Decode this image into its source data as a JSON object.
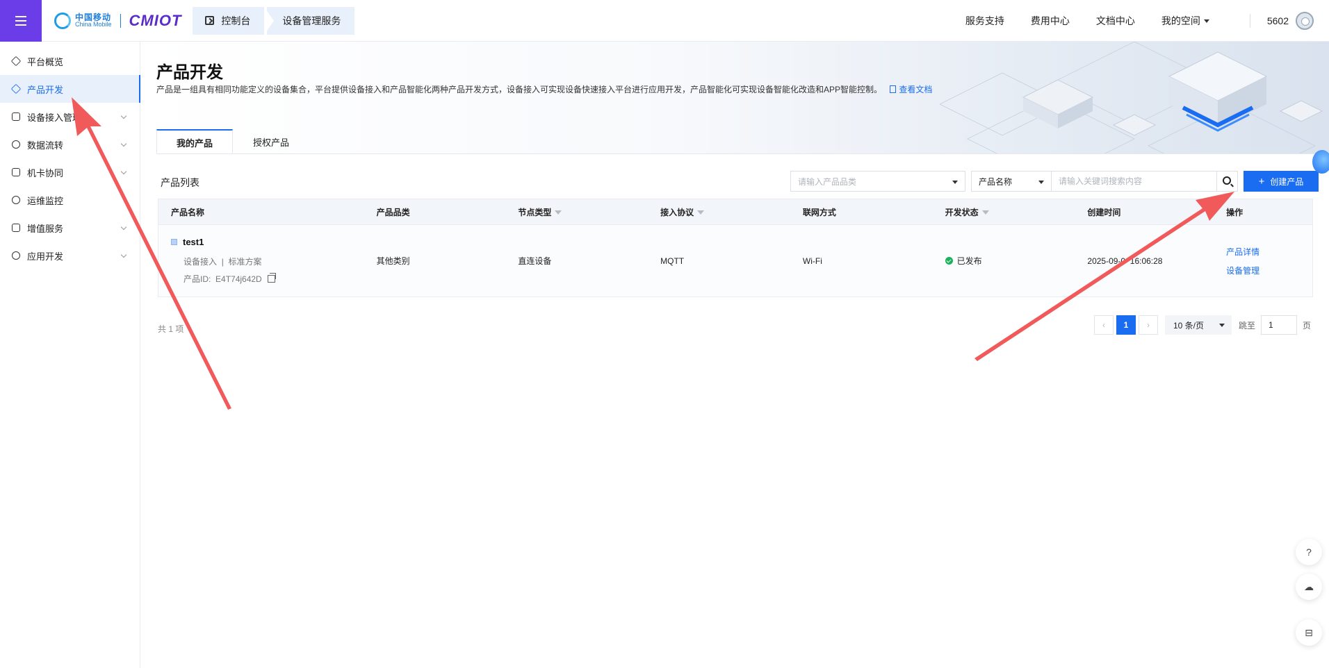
{
  "header": {
    "logo_cn": "中国移动",
    "logo_en": "China Mobile",
    "brand": "CMIOT",
    "crumbs": [
      "控制台",
      "设备管理服务"
    ],
    "nav": [
      "服务支持",
      "费用中心",
      "文档中心",
      "我的空间"
    ],
    "user_id": "5602"
  },
  "sidebar": {
    "items": [
      {
        "label": "平台概览",
        "icon": "overview-icon",
        "expandable": false
      },
      {
        "label": "产品开发",
        "icon": "product-cube-icon",
        "expandable": false,
        "active": true
      },
      {
        "label": "设备接入管理",
        "icon": "device-access-icon",
        "expandable": true
      },
      {
        "label": "数据流转",
        "icon": "data-flow-icon",
        "expandable": true
      },
      {
        "label": "机卡协同",
        "icon": "card-sync-icon",
        "expandable": true
      },
      {
        "label": "运维监控",
        "icon": "monitor-icon",
        "expandable": false
      },
      {
        "label": "增值服务",
        "icon": "send-icon",
        "expandable": true
      },
      {
        "label": "应用开发",
        "icon": "app-dev-icon",
        "expandable": true
      }
    ]
  },
  "page": {
    "title": "产品开发",
    "description": "产品是一组具有相同功能定义的设备集合，平台提供设备接入和产品智能化两种产品开发方式，设备接入可实现设备快速接入平台进行应用开发，产品智能化可实现设备智能化改造和APP智能控制。",
    "doc_link": "查看文档",
    "tabs": [
      "我的产品",
      "授权产品"
    ],
    "active_tab": 0
  },
  "list": {
    "title": "产品列表",
    "category_placeholder": "请输入产品品类",
    "field_select": "产品名称",
    "keyword_placeholder": "请输入关键词搜索内容",
    "create_label": "创建产品",
    "columns": [
      "产品名称",
      "产品品类",
      "节点类型",
      "接入协议",
      "联网方式",
      "开发状态",
      "创建时间",
      "操作"
    ],
    "rows": [
      {
        "name": "test1",
        "access": "设备接入",
        "separator": "|",
        "solution": "标准方案",
        "id_label": "产品ID:",
        "id": "E4T74j642D",
        "category": "其他类别",
        "node_type": "直连设备",
        "protocol": "MQTT",
        "network": "Wi-Fi",
        "status": "已发布",
        "created": "2025-09-0  16:06:28",
        "actions": [
          "产品详情",
          "设备管理"
        ]
      }
    ]
  },
  "pagination": {
    "total": "共 1 项",
    "prev": "‹",
    "current": "1",
    "next": "›",
    "page_size": "10 条/页",
    "jump_label": "跳至",
    "jump_value": "1",
    "page_suffix": "页"
  },
  "float_tools": [
    "help-icon",
    "cloud-icon",
    "minimize-icon"
  ],
  "colors": {
    "brand_purple": "#6a3de8",
    "primary_blue": "#1a6cf0",
    "status_green": "#19b15a",
    "annotation_red": "#f05a5a"
  }
}
